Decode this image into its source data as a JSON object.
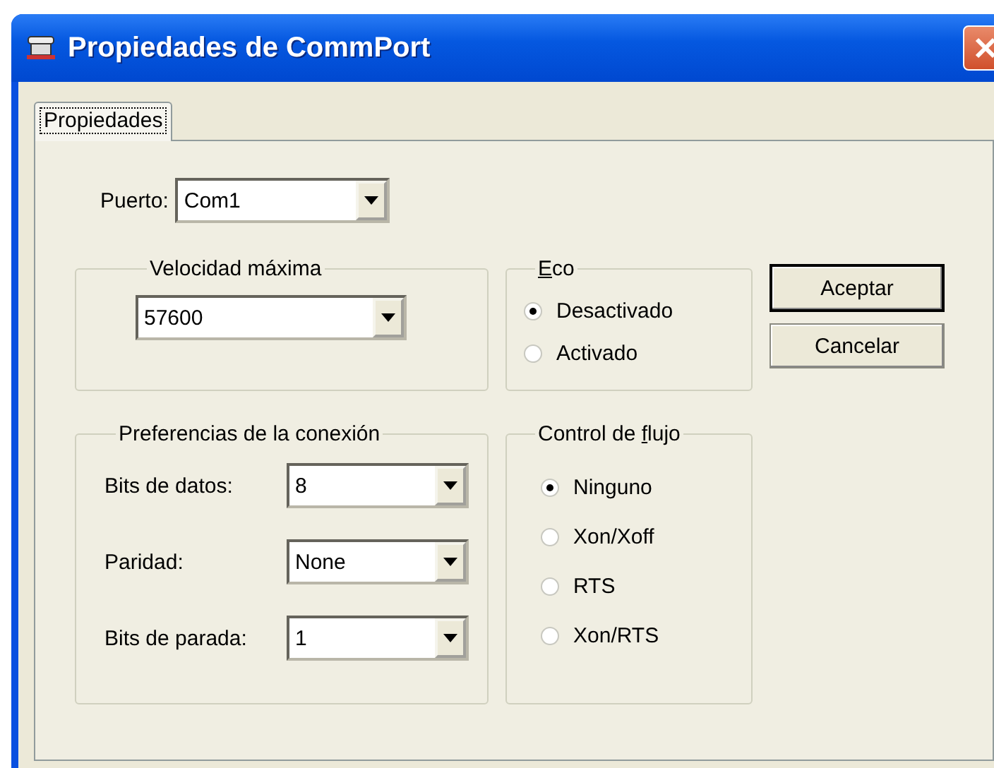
{
  "window": {
    "title": "Propiedades de CommPort"
  },
  "tabs": [
    {
      "label": "Propiedades",
      "selected": true
    }
  ],
  "port": {
    "label": "Puerto:",
    "value": "Com1"
  },
  "speed_group": {
    "title": "Velocidad máxima",
    "value": "57600"
  },
  "echo_group": {
    "title_key": "E",
    "title_after": "co",
    "options": [
      {
        "label": "Desactivado",
        "selected": true
      },
      {
        "label": "Activado",
        "selected": false
      }
    ]
  },
  "buttons": [
    {
      "label": "Aceptar",
      "default": true
    },
    {
      "label": "Cancelar",
      "default": false
    }
  ],
  "connection_group": {
    "title": "Preferencias de la conexión",
    "fields": [
      {
        "label": "Bits de datos:",
        "value": "8"
      },
      {
        "label": "Paridad:",
        "value": "None"
      },
      {
        "label": "Bits de parada:",
        "value": "1"
      }
    ]
  },
  "flow_group": {
    "title_before": "Control de ",
    "title_key": "f",
    "title_after": "lujo",
    "options": [
      {
        "label": "Ninguno",
        "selected": true
      },
      {
        "label": "Xon/Xoff",
        "selected": false
      },
      {
        "label": "RTS",
        "selected": false
      },
      {
        "label": "Xon/RTS",
        "selected": false
      }
    ]
  }
}
